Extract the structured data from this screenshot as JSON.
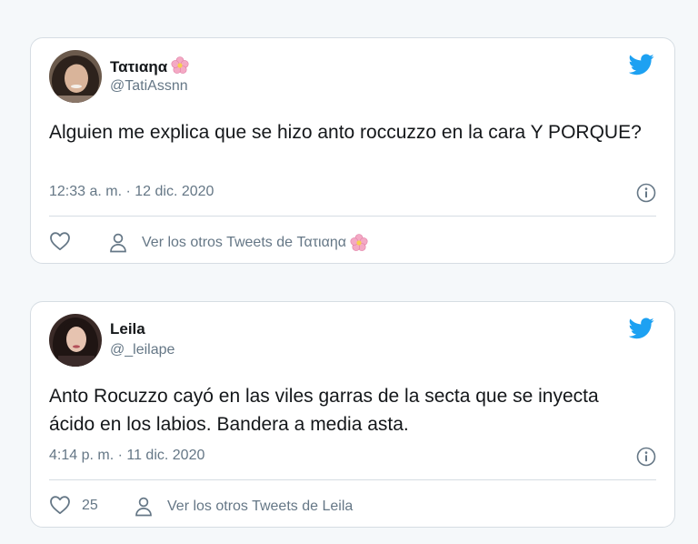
{
  "colors": {
    "twitter_blue": "#1da1f2",
    "secondary_text": "#657786",
    "primary_text": "#14171a",
    "border": "#d6dde3",
    "background": "#f5f8fa"
  },
  "tweets": [
    {
      "display_name": "Τατιαηα",
      "name_emoji": "cherry-blossom-icon",
      "handle": "@TatiAssnn",
      "text": "Alguien me explica que se hizo anto roccuzzo en la cara Y PORQUE?",
      "timestamp": "12:33 a. m. · 12 dic. 2020",
      "like_count": "",
      "profile_link": "Ver los otros Tweets de Τατιαηα",
      "icons": [
        "twitter-bird-icon",
        "info-icon",
        "heart-icon",
        "person-icon"
      ]
    },
    {
      "display_name": "Leila",
      "handle": "@_leilape",
      "text": "Anto Rocuzzo cayó en las viles garras de la secta que se inyecta ácido en los labios. Bandera a media asta.",
      "timestamp": "4:14 p. m. · 11 dic. 2020",
      "like_count": "25",
      "profile_link": "Ver los otros Tweets de Leila",
      "icons": [
        "twitter-bird-icon",
        "info-icon",
        "heart-icon",
        "person-icon"
      ]
    }
  ]
}
